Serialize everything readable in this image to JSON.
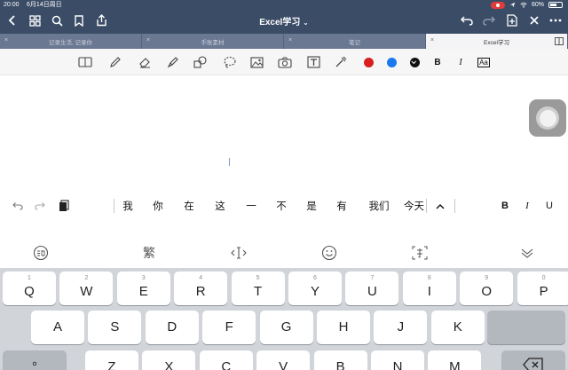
{
  "status": {
    "time": "20:00",
    "date": "6月14日周日",
    "battery": "60%",
    "battery_level": 0.6
  },
  "header": {
    "title": "Excel学习",
    "title_caret": "⌄"
  },
  "tabs": [
    {
      "label": "记录生活, 记录你",
      "active": false
    },
    {
      "label": "手账素材",
      "active": false
    },
    {
      "label": "笔记",
      "active": false
    },
    {
      "label": "Excel学习",
      "active": true
    }
  ],
  "tab_close_glyph": "×",
  "colors": {
    "header_bg": "#3b4c67",
    "red": "#d81e1e",
    "blue": "#1a79ee",
    "black": "#111111",
    "tab_inactive": "#6b7892"
  },
  "toolbar": {
    "bold": "B",
    "italic": "I",
    "text_box": "Aa"
  },
  "suggestions": {
    "candidates": [
      "我",
      "你",
      "在",
      "这",
      "一",
      "不",
      "是",
      "有",
      "我们",
      "今天"
    ],
    "expand": "^",
    "bold": "B",
    "italic": "I",
    "underline": "U"
  },
  "ime_bar": {
    "traditional": "繁"
  },
  "keyboard": {
    "row1": [
      {
        "k": "Q",
        "n": "1"
      },
      {
        "k": "W",
        "n": "2"
      },
      {
        "k": "E",
        "n": "3"
      },
      {
        "k": "R",
        "n": "4"
      },
      {
        "k": "T",
        "n": "5"
      },
      {
        "k": "Y",
        "n": "6"
      },
      {
        "k": "U",
        "n": "7"
      },
      {
        "k": "I",
        "n": "8"
      },
      {
        "k": "O",
        "n": "9"
      },
      {
        "k": "P",
        "n": "0"
      }
    ],
    "row2": [
      {
        "k": "A",
        "n": ""
      },
      {
        "k": "S",
        "n": ""
      },
      {
        "k": "D",
        "n": ""
      },
      {
        "k": "F",
        "n": ""
      },
      {
        "k": "G",
        "n": ""
      },
      {
        "k": "H",
        "n": ""
      },
      {
        "k": "J",
        "n": ""
      },
      {
        "k": "K",
        "n": ""
      },
      {
        "k": "L",
        "n": ""
      }
    ],
    "row3": [
      {
        "k": "Z"
      },
      {
        "k": "X"
      },
      {
        "k": "C"
      },
      {
        "k": "V"
      },
      {
        "k": "B"
      },
      {
        "k": "N"
      },
      {
        "k": "M"
      }
    ],
    "shift_symbol": "°"
  }
}
